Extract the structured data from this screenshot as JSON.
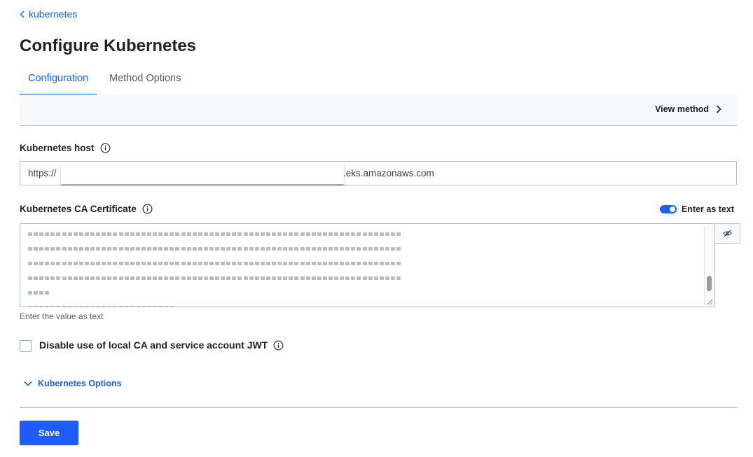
{
  "breadcrumb": {
    "label": "kubernetes"
  },
  "page": {
    "title": "Configure Kubernetes"
  },
  "tabs": [
    {
      "label": "Configuration",
      "active": true
    },
    {
      "label": "Method Options",
      "active": false
    }
  ],
  "toolbar": {
    "view_method_label": "View method"
  },
  "host": {
    "label": "Kubernetes host",
    "value_prefix": "https://",
    "value_suffix": ".eks.amazonaws.com"
  },
  "ca_certificate": {
    "label": "Kubernetes CA Certificate",
    "toggle_label": "Enter as text",
    "toggle_on": true,
    "helper_text": "Enter the value as text"
  },
  "disable_local_ca": {
    "label": "Disable use of local CA and service account JWT",
    "checked": false
  },
  "options_toggle": {
    "label": "Kubernetes Options"
  },
  "actions": {
    "save_label": "Save"
  },
  "colors": {
    "accent": "#1563ff",
    "button": "#1d5cff"
  }
}
